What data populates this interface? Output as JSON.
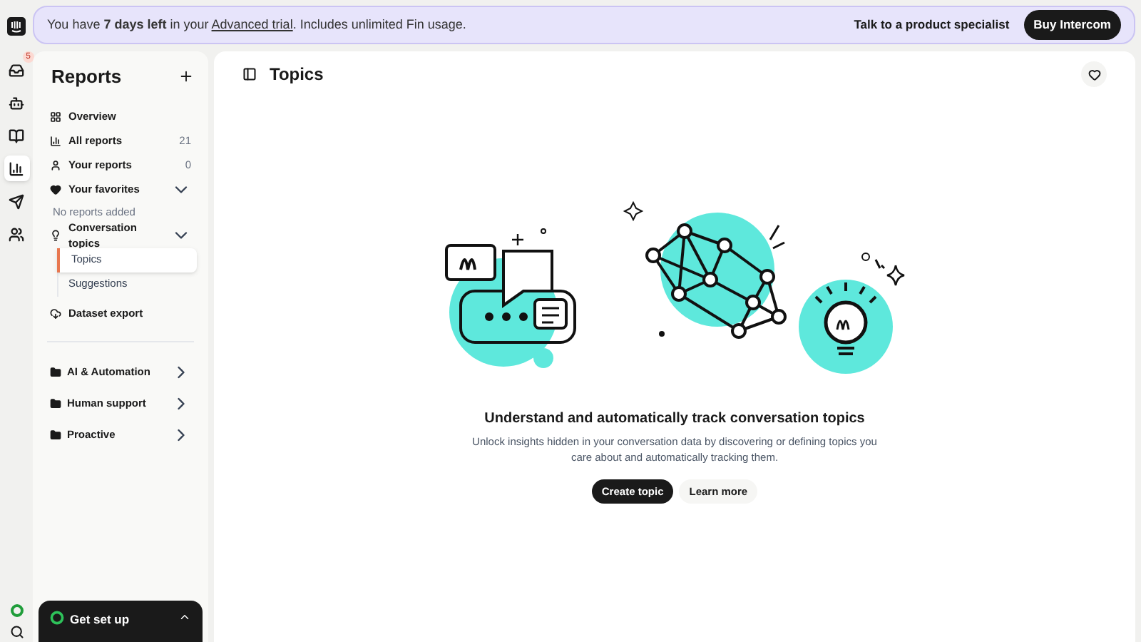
{
  "rail": {
    "items": [
      {
        "selected": false,
        "badge": "5"
      },
      {
        "selected": false
      },
      {
        "selected": false
      },
      {
        "selected": true
      },
      {
        "selected": false
      },
      {
        "selected": false
      }
    ]
  },
  "banner": {
    "before": "You have **7 days left** in your ",
    "link": "Advanced trial",
    "after": ". Includes unlimited Fin usage.",
    "specialist": "Talk to a product specialist",
    "buy": "Buy Intercom"
  },
  "sidebar": {
    "title": "Reports",
    "nav": [
      {
        "kind": "link",
        "label": "Overview"
      },
      {
        "kind": "link",
        "label": "All reports",
        "count": "21"
      },
      {
        "kind": "link",
        "label": "Your reports",
        "count": "0"
      },
      {
        "kind": "group",
        "label": "Your favorites",
        "expanded": true,
        "empty_note": "No reports added"
      },
      {
        "kind": "group",
        "label": "Conversation topics",
        "expanded": true,
        "children": [
          {
            "label": "Topics",
            "selected": true
          },
          {
            "label": "Suggestions",
            "selected": false
          }
        ]
      },
      {
        "kind": "link",
        "label": "Dataset export"
      }
    ],
    "folders": [
      {
        "label": "AI & Automation",
        "expanded": false
      },
      {
        "label": "Human support",
        "expanded": false
      },
      {
        "label": "Proactive",
        "expanded": false
      }
    ],
    "setup": {
      "title": "Get set up",
      "expanded": true
    }
  },
  "page": {
    "title": "Topics",
    "empty_state": {
      "heading": "Understand and automatically track conversation topics",
      "body": "Unlock insights hidden in your conversation data by discovering or defining topics you care about and automatically tracking them.",
      "primary": "Create topic",
      "secondary": "Learn more"
    }
  }
}
